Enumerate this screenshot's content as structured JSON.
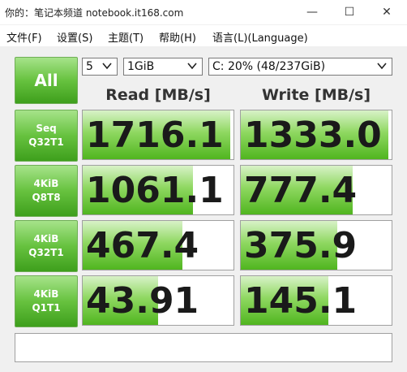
{
  "window": {
    "title": "你的：笔记本频道 notebook.it168.com",
    "minimize_glyph": "—",
    "maximize_glyph": "☐",
    "close_glyph": "✕"
  },
  "menu": [
    {
      "label": "文件(F)"
    },
    {
      "label": "设置(S)"
    },
    {
      "label": "主题(T)"
    },
    {
      "label": "帮助(H)"
    },
    {
      "label": "语言(L)(Language)"
    }
  ],
  "controls": {
    "all_label": "All",
    "count_value": "5",
    "size_value": "1GiB",
    "drive_value": "C: 20% (48/237GiB)"
  },
  "columns": {
    "read": "Read [MB/s]",
    "write": "Write [MB/s]"
  },
  "tests": [
    {
      "line1": "Seq",
      "line2": "Q32T1",
      "read": "1716.1",
      "write": "1333.0",
      "read_fill": 0.98,
      "write_fill": 0.98
    },
    {
      "line1": "4KiB",
      "line2": "Q8T8",
      "read": "1061.1",
      "write": "777.4",
      "read_fill": 0.73,
      "write_fill": 0.74
    },
    {
      "line1": "4KiB",
      "line2": "Q32T1",
      "read": "467.4",
      "write": "375.9",
      "read_fill": 0.66,
      "write_fill": 0.64
    },
    {
      "line1": "4KiB",
      "line2": "Q1T1",
      "read": "43.91",
      "write": "145.1",
      "read_fill": 0.5,
      "write_fill": 0.58
    }
  ],
  "status_text": ""
}
